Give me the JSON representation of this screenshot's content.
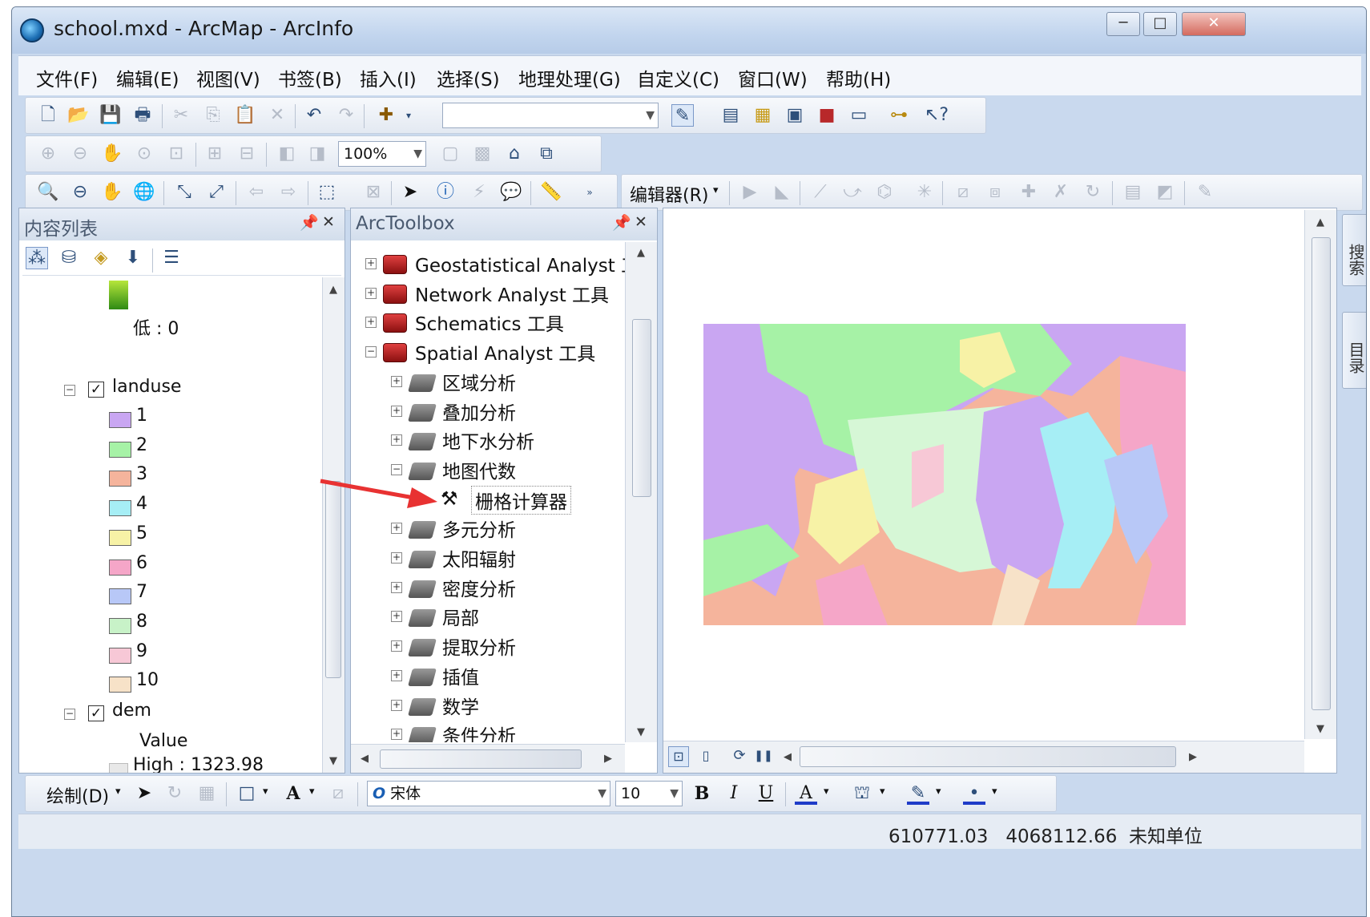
{
  "window": {
    "title": "school.mxd - ArcMap - ArcInfo",
    "controls": {
      "minimize": "─",
      "maximize": "□",
      "close": "✕"
    }
  },
  "menu": [
    "文件(F)",
    "编辑(E)",
    "视图(V)",
    "书签(B)",
    "插入(I)",
    "选择(S)",
    "地理处理(G)",
    "自定义(C)",
    "窗口(W)",
    "帮助(H)"
  ],
  "toolbars": {
    "scale_combo": "",
    "zoom_combo": "100%",
    "editor_label": "编辑器(R)",
    "draw_label": "绘制(D)",
    "font_name": "宋体",
    "font_size": "10",
    "bold": "B",
    "italic": "I",
    "underline": "U",
    "text_tool": "A"
  },
  "toc": {
    "title": "内容列表",
    "low_label": "低 : 0",
    "layers": [
      {
        "name": "landuse",
        "checked": true
      },
      {
        "name": "dem",
        "checked": true
      }
    ],
    "landuse_classes": [
      {
        "label": "1",
        "color": "#c9a6f2"
      },
      {
        "label": "2",
        "color": "#a6f2a6"
      },
      {
        "label": "3",
        "color": "#f5b49c"
      },
      {
        "label": "4",
        "color": "#a6eef5"
      },
      {
        "label": "5",
        "color": "#f7f2a6"
      },
      {
        "label": "6",
        "color": "#f5a6c8"
      },
      {
        "label": "7",
        "color": "#b8c8f7"
      },
      {
        "label": "8",
        "color": "#c8f2c8"
      },
      {
        "label": "9",
        "color": "#f7c8d6"
      },
      {
        "label": "10",
        "color": "#f7e2c8"
      }
    ],
    "dem_value_label": "Value",
    "dem_high_label": "High : 1323.98"
  },
  "arctoolbox": {
    "title": "ArcToolbox",
    "toolboxes": [
      {
        "label": "Geostatistical Analyst 工具",
        "expanded": false
      },
      {
        "label": "Network Analyst 工具",
        "expanded": false
      },
      {
        "label": "Schematics 工具",
        "expanded": false
      },
      {
        "label": "Spatial Analyst 工具",
        "expanded": true
      }
    ],
    "toolsets": [
      {
        "label": "区域分析"
      },
      {
        "label": "叠加分析"
      },
      {
        "label": "地下水分析"
      },
      {
        "label": "地图代数",
        "expanded": true
      },
      {
        "label": "多元分析"
      },
      {
        "label": "太阳辐射"
      },
      {
        "label": "密度分析"
      },
      {
        "label": "局部"
      },
      {
        "label": "提取分析"
      },
      {
        "label": "插值"
      },
      {
        "label": "数学"
      },
      {
        "label": "条件分析"
      }
    ],
    "tool": "栅格计算器"
  },
  "side_tabs": [
    "搜索",
    "目录"
  ],
  "status": {
    "x": "610771.03",
    "y": "4068112.66",
    "units": "未知单位"
  },
  "colors": {
    "accent_arrow": "#e83232",
    "window_frame": "#c9d9ee"
  }
}
